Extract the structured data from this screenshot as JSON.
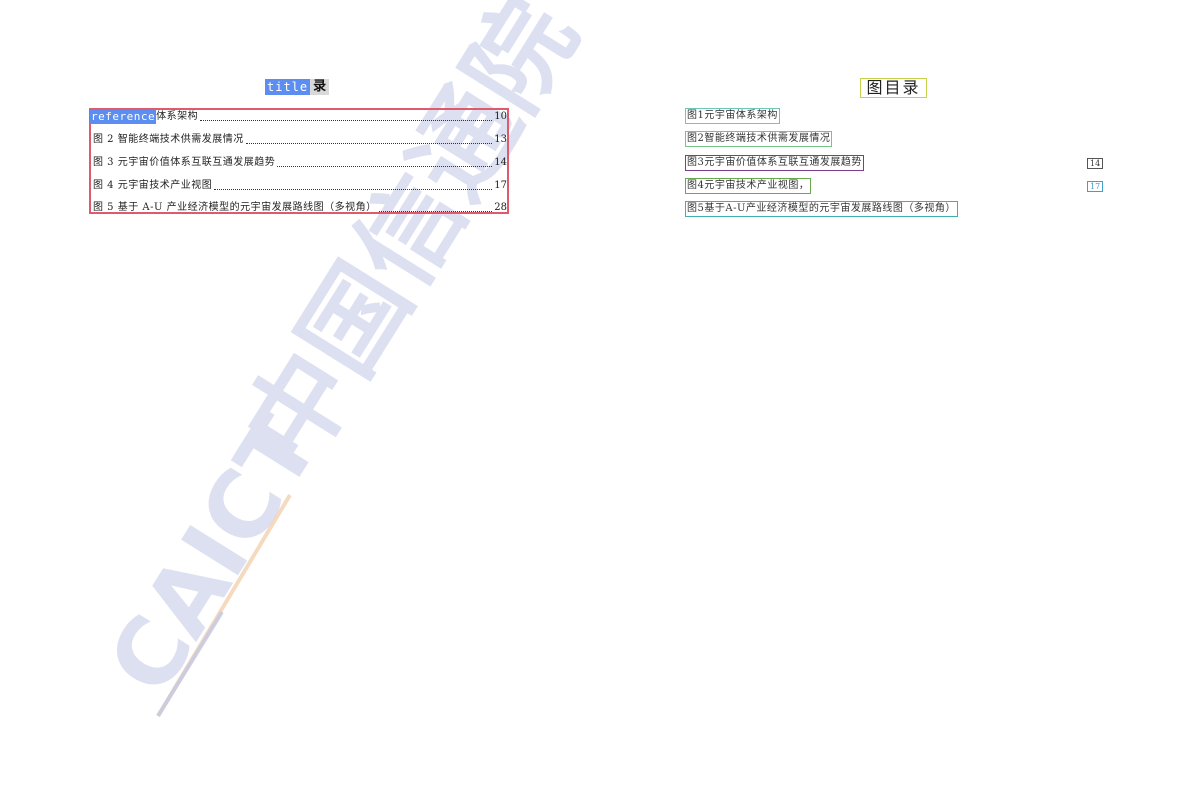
{
  "left_page": {
    "title_tag": "title",
    "title_rest": "录",
    "toc": [
      {
        "tag": "reference",
        "text": "体系架构",
        "page": "10"
      },
      {
        "text": "图 2 智能终端技术供需发展情况",
        "page": "13"
      },
      {
        "text": "图 3 元宇宙价值体系互联互通发展趋势",
        "page": "14"
      },
      {
        "text": "图 4 元宇宙技术产业视图",
        "page": "17"
      },
      {
        "text": "图 5 基于 A-U 产业经济模型的元宇宙发展路线图（多视角）",
        "page": "28"
      }
    ],
    "box_color": "#e05a6e"
  },
  "right_page": {
    "title": "图目录",
    "items": [
      {
        "text": "图1元宇宙体系架构",
        "color": "#6fc7b8"
      },
      {
        "text": "图2智能终端技术供需发展情况",
        "color": "#77c48a"
      },
      {
        "text": "图3元宇宙价值体系互联互通发展趋势",
        "color": "#7b3d8f"
      },
      {
        "text": "图4元宇宙技术产业视图，",
        "color": "#6aa84f"
      },
      {
        "text": "图5基于A-U产业经济模型的元宇宙发展路线图（多视角）",
        "color": "#3fb0b0"
      }
    ],
    "pages": [
      {
        "text": "14",
        "color": "#555555"
      },
      {
        "text": "17",
        "color": "#3fa0c8"
      }
    ]
  },
  "watermark": {
    "latin": "CAICT",
    "cjk": "中国信通院",
    "color": "#c3c8e4",
    "accent": "#f5d2b0"
  }
}
